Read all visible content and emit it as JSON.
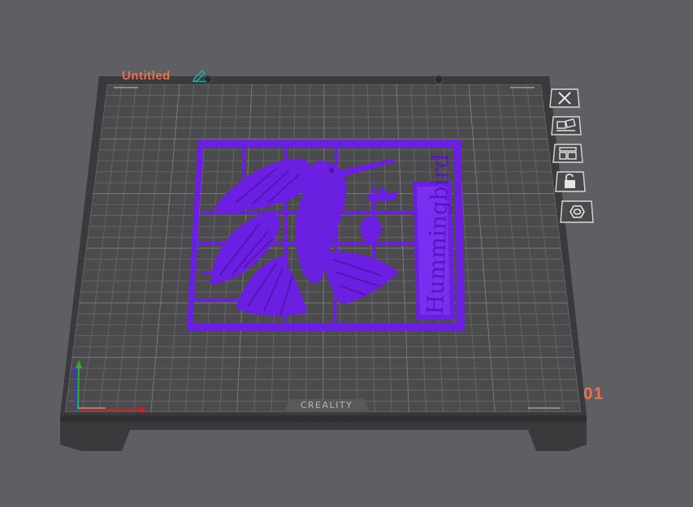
{
  "plate": {
    "name": "Untitled",
    "index": "01",
    "brand": "CREALITY"
  },
  "model": {
    "label": "Hummingbird",
    "color": "#6b1fe0"
  },
  "colors": {
    "background": "#5f5f63",
    "bed_frame": "#3b3b3d",
    "bed_surface": "#4a4a4c",
    "grid_line": "#6e6e70",
    "accent": "#e8734a",
    "axis_x": "#d11f1f",
    "axis_y": "#2fae2f",
    "axis_z": "#2f3fd6"
  },
  "toolbar": [
    {
      "name": "delete-plate-button",
      "icon": "close-icon"
    },
    {
      "name": "auto-orient-button",
      "icon": "orient-icon"
    },
    {
      "name": "arrange-button",
      "icon": "arrange-icon"
    },
    {
      "name": "lock-plate-button",
      "icon": "unlock-icon"
    },
    {
      "name": "plate-settings-button",
      "icon": "hex-nut-icon"
    }
  ]
}
